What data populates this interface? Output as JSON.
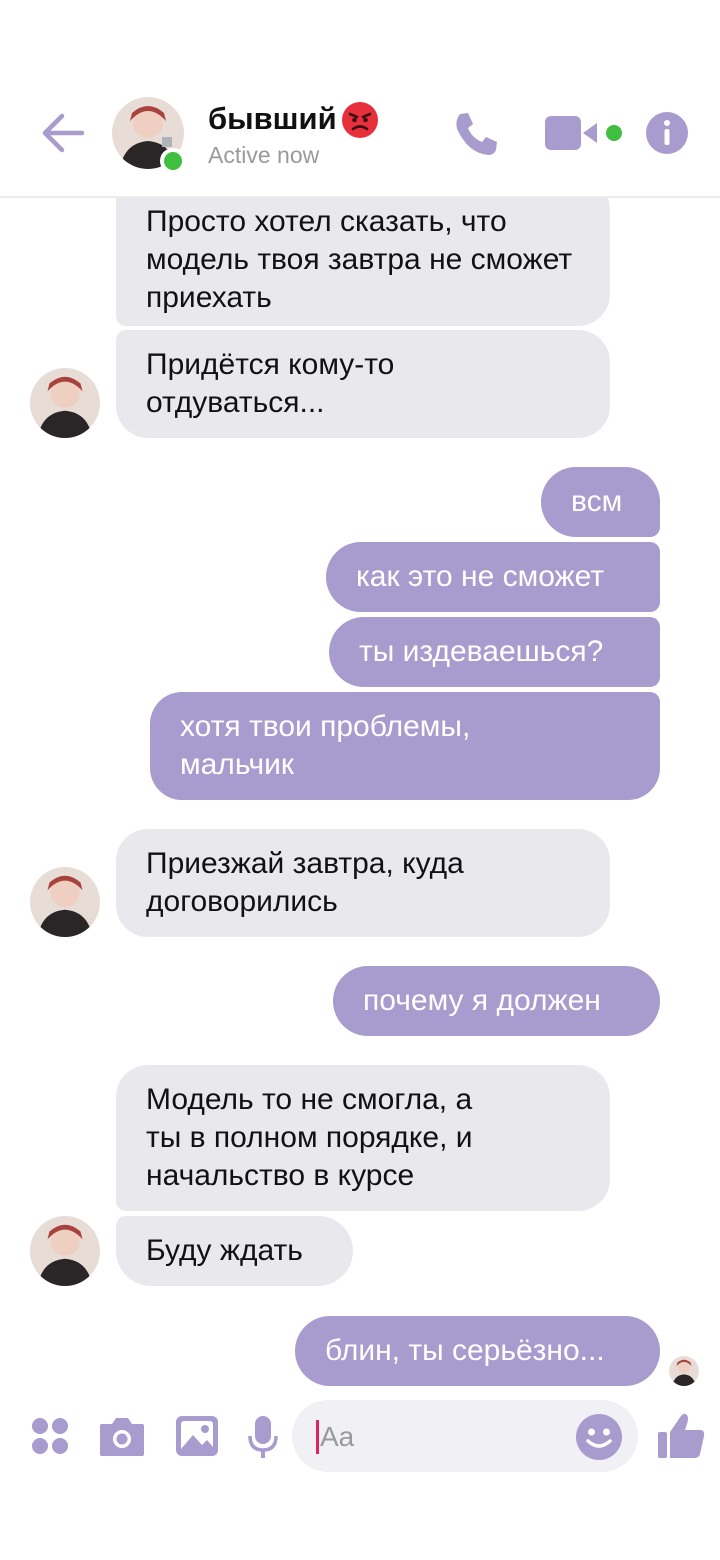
{
  "header": {
    "contact_name": "бывший",
    "status": "Active now"
  },
  "messages": [
    {
      "side": "in",
      "text": "Просто хотел сказать, что модель твоя завтра не сможет приехать"
    },
    {
      "side": "in",
      "text": "Придётся кому-то отдуваться..."
    },
    {
      "side": "out",
      "text": "всм"
    },
    {
      "side": "out",
      "text": "как это не сможет"
    },
    {
      "side": "out",
      "text": "ты издеваешься?"
    },
    {
      "side": "out",
      "text": "хотя твои проблемы, мальчик"
    },
    {
      "side": "in",
      "text": "Приезжай завтра, куда договорились"
    },
    {
      "side": "out",
      "text": "почему я должен"
    },
    {
      "side": "in",
      "text": "Модель то не смогла, а ты в полном порядке, и начальство в курсе"
    },
    {
      "side": "in",
      "text": "Буду ждать"
    },
    {
      "side": "out",
      "text": "блин, ты серьёзно..."
    }
  ],
  "composer": {
    "placeholder": "Aa"
  },
  "icons": {
    "back": "arrow-left-icon",
    "call": "phone-icon",
    "video": "video-camera-icon",
    "info": "info-icon",
    "apps": "four-dots-icon",
    "camera": "camera-icon",
    "gallery": "image-icon",
    "mic": "microphone-icon",
    "emoji": "smiley-icon",
    "like": "thumbs-up-icon"
  },
  "colors": {
    "accent": "#a89bcd",
    "incoming_bubble": "#e9e8ed",
    "online": "#3fbf3f",
    "caret": "#e0245e"
  }
}
